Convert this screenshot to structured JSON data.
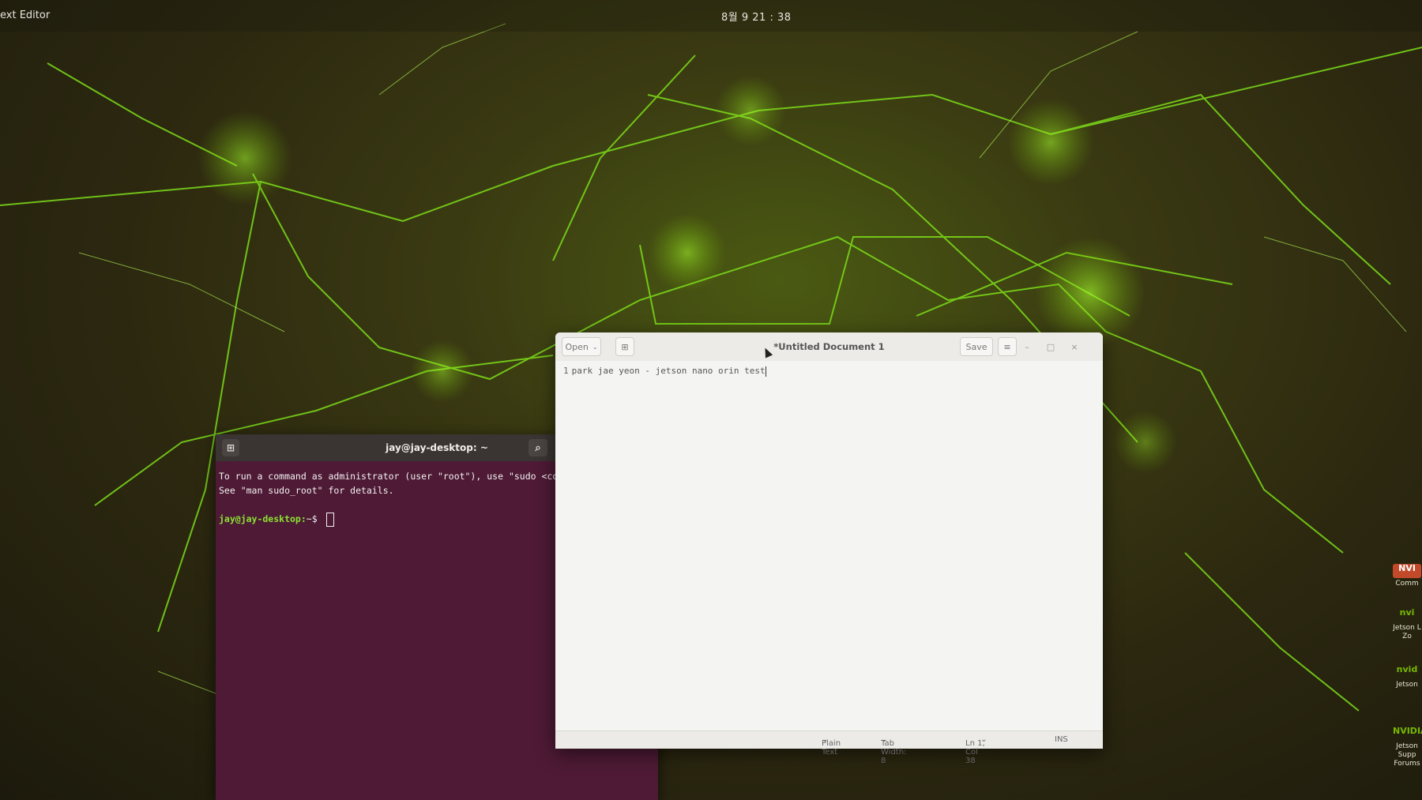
{
  "topbar": {
    "app_name": "ext Editor",
    "clock": "8월 9 21 : 38"
  },
  "terminal": {
    "title": "jay@jay-desktop: ~",
    "lines": [
      "To run a command as administrator (user \"root\"), use \"sudo <comm",
      "See \"man sudo_root\" for details."
    ],
    "prompt_user": "jay@jay-desktop:",
    "prompt_suffix": "~$ "
  },
  "editor": {
    "open_label": "Open",
    "title": "*Untitled Document 1",
    "save_label": "Save",
    "line_number": "1",
    "line_text": "park jae yeon - jetson nano orin test",
    "status": {
      "language": "Plain Text",
      "tab_width": "Tab Width: 8",
      "position": "Ln 1, Col 38",
      "mode": "INS"
    }
  },
  "desktop_icons": [
    {
      "glyph": "NVI",
      "label": "Comm"
    },
    {
      "glyph": "nvi",
      "label": "Jetson L Zo"
    },
    {
      "glyph": "nvid",
      "label": "Jetson"
    },
    {
      "glyph": "NVIDIA",
      "label": "Jetson Supp Forums"
    }
  ],
  "colors": {
    "terminal_bg": "#4e1a35",
    "prompt_user": "#8ae234",
    "nvidia_green": "#76b900"
  }
}
